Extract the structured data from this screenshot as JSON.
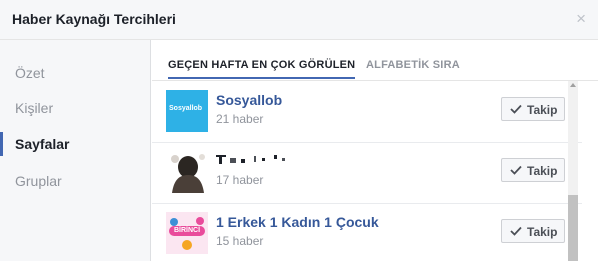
{
  "dialog": {
    "title": "Haber Kaynağı Tercihleri",
    "close_glyph": "×"
  },
  "sidebar": {
    "items": [
      {
        "label": "Özet"
      },
      {
        "label": "Kişiler"
      },
      {
        "label": "Sayfalar",
        "active": true
      },
      {
        "label": "Gruplar"
      }
    ]
  },
  "tabs": [
    {
      "label": "GEÇEN HAFTA EN ÇOK GÖRÜLEN",
      "active": true
    },
    {
      "label": "ALFABETİK SIRA",
      "active": false
    }
  ],
  "pages": [
    {
      "name": "Sosyallob",
      "meta": "21 haber",
      "button": "Takip",
      "thumb_text": "Sosyallob"
    },
    {
      "name": "",
      "meta": "17 haber",
      "button": "Takip"
    },
    {
      "name": "1 Erkek 1 Kadın 1 Çocuk",
      "meta": "15 haber",
      "button": "Takip",
      "thumb_text": "BİRİNCİ"
    }
  ],
  "colors": {
    "accent": "#4267b2",
    "link": "#365899",
    "sosyallob_bg": "#2eb1e6",
    "pink": "#e94b9b"
  }
}
